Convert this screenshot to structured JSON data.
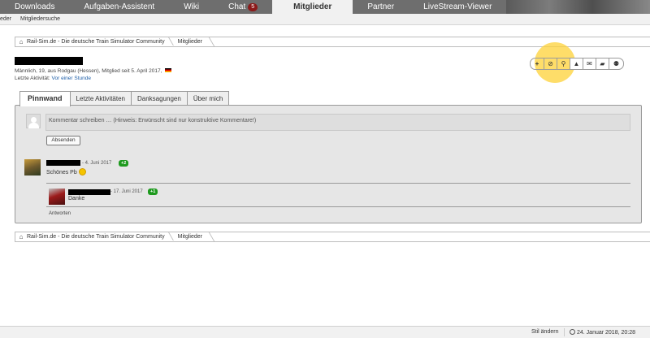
{
  "nav": {
    "tabs": [
      {
        "label": "Downloads"
      },
      {
        "label": "Aufgaben-Assistent"
      },
      {
        "label": "Wiki"
      },
      {
        "label": "Chat",
        "badge": "5"
      },
      {
        "label": "Mitglieder",
        "active": true
      },
      {
        "label": "Partner"
      },
      {
        "label": "LiveStream-Viewer"
      }
    ]
  },
  "subnav": {
    "left": "eder",
    "search": "Mitgliedersuche"
  },
  "breadcrumb": {
    "items": [
      "Rail-Sim.de - Die deutsche Train Simulator Community",
      "Mitglieder"
    ]
  },
  "profile": {
    "meta": "Männlich, 19, aus Rodgau (Hessen), Mitglied seit 5. April 2017,",
    "activity_label": "Letzte Aktivität:",
    "activity_value": "Vor einer Stunde"
  },
  "actions": {
    "icons": [
      "plus-icon",
      "ban-icon",
      "search-icon",
      "warning-icon",
      "mail-icon",
      "chat-icon",
      "users-icon"
    ],
    "glyphs": [
      "+",
      "⊘",
      "⚲",
      "▲",
      "✉",
      "▰",
      "⚉"
    ]
  },
  "tabs": [
    {
      "label": "Pinnwand",
      "active": true
    },
    {
      "label": "Letzte Aktivitäten"
    },
    {
      "label": "Danksagungen"
    },
    {
      "label": "Über mich"
    }
  ],
  "wall": {
    "comment_placeholder": "Kommentar schreiben … (Hinweis: Erwünscht sind nur konstruktive Kommentare!)",
    "send_label": "Absenden",
    "post": {
      "date": "- 4. Juni 2017",
      "likes": "+2",
      "text": "Schönes Pb"
    },
    "reply": {
      "date": "- 17. Juni 2017",
      "likes": "+1",
      "text": "Danke"
    },
    "reply_link": "Antworten"
  },
  "status": {
    "style_change": "Stil ändern",
    "datetime": "24. Januar 2018, 20:28"
  }
}
